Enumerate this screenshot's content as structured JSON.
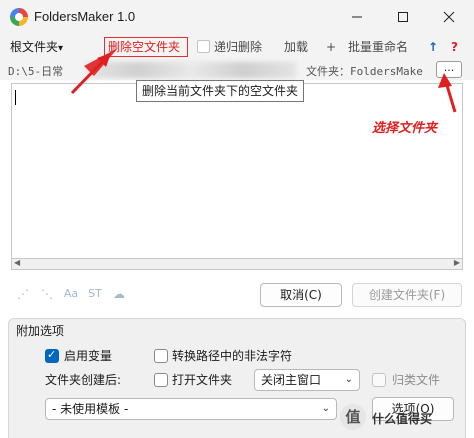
{
  "window": {
    "title": "FoldersMaker 1.0"
  },
  "toolbar": {
    "root_label": "根文件夹",
    "root_arrow": "▾",
    "delete_empty": "删除空文件夹",
    "recursive_delete": "递归删除",
    "load": "加载",
    "plus": "+",
    "batch_rename": "批量重命名",
    "up_arrow": "↑",
    "help": "?"
  },
  "path": {
    "left": "D:\\5-日常",
    "right": "文件夹：FoldersMake",
    "browse_label": "..."
  },
  "tooltip": "删除当前文件夹下的空文件夹",
  "annotation": "选择文件夹",
  "buttons": {
    "cancel": "取消(C)",
    "create": "创建文件夹(F)",
    "options": "选项(O)"
  },
  "options": {
    "group_title": "附加选项",
    "enable_vars": "启用变量",
    "convert_illegal": "转换路径中的非法字符",
    "after_create_label": "文件夹创建后:",
    "open_folder": "打开文件夹",
    "close_main_window": "关闭主窗口",
    "classify_files": "归类文件",
    "template_select": "- 未使用模板 -",
    "enable_vars_checked": true,
    "convert_illegal_checked": false,
    "open_folder_checked": false,
    "classify_files_checked": false
  },
  "watermark": {
    "badge": "值",
    "text": "什么值得买"
  },
  "colors": {
    "accent": "#0067c0",
    "highlight_red": "#e03030",
    "titlebar_bg": "#f3f3f3",
    "panel_bg": "#f0f0f0"
  }
}
